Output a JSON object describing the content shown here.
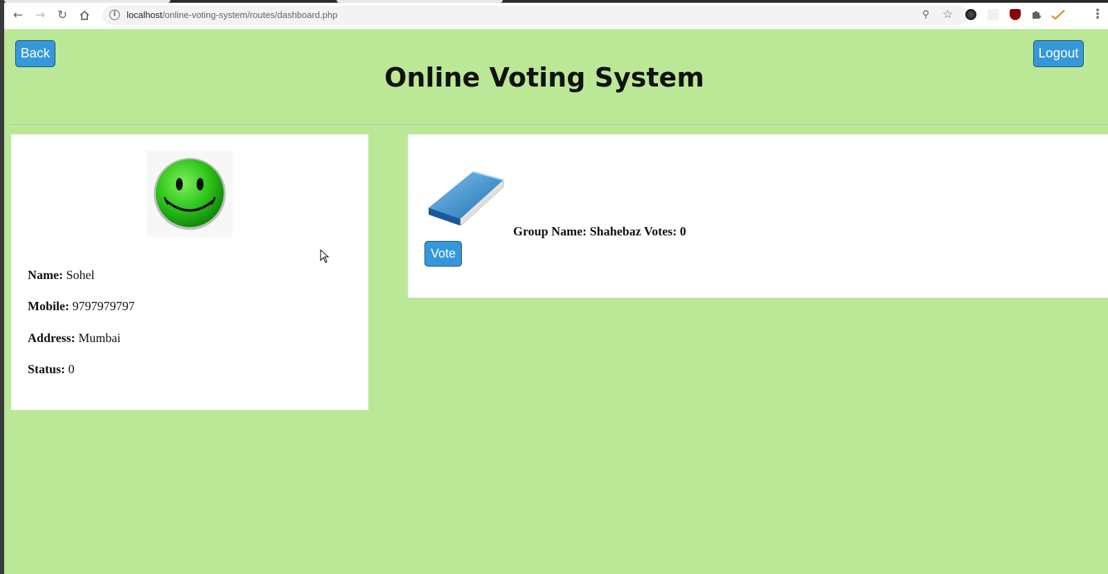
{
  "browser": {
    "url_host": "localhost",
    "url_path": "/online-voting-system/routes/dashboard.php"
  },
  "header": {
    "back_label": "Back",
    "logout_label": "Logout",
    "title": "Online Voting System"
  },
  "profile": {
    "avatar_icon": "smiley-face-icon",
    "name_label": "Name:",
    "name_value": "Sohel",
    "mobile_label": "Mobile:",
    "mobile_value": "9797979797",
    "address_label": "Address:",
    "address_value": "Mumbai",
    "status_label": "Status:",
    "status_value": "0"
  },
  "group": {
    "icon": "book-icon",
    "vote_label": "Vote",
    "name_label": "Group Name:",
    "name_value": "Shahebaz",
    "votes_label": "Votes:",
    "votes_value": "0"
  },
  "colors": {
    "page_background": "#bae897",
    "button": "#3498db",
    "panel": "#ffffff"
  }
}
